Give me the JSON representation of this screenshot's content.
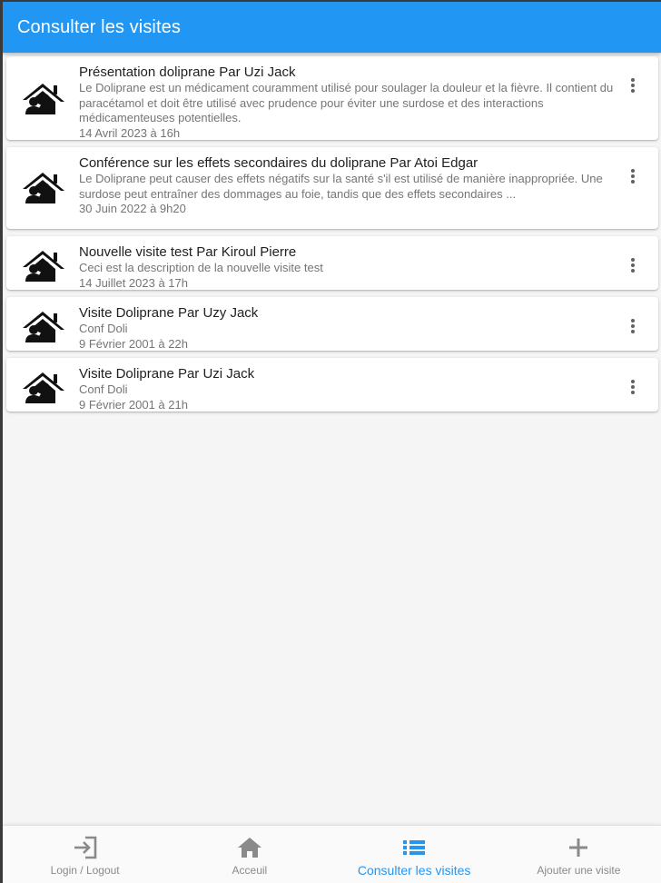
{
  "app": {
    "title": "Consulter les visites",
    "accent_color": "#2196f3"
  },
  "visits": [
    {
      "title": "Présentation doliprane Par Uzi Jack",
      "description": "Le Doliprane est un médicament couramment utilisé pour soulager la douleur et la fièvre. Il contient du paracétamol et doit être utilisé avec prudence pour éviter une surdose et des interactions médicamenteuses potentielles.",
      "date": "14 Avril 2023 à 16h",
      "icon": "people-house-icon"
    },
    {
      "title": "Conférence sur les effets secondaires du doliprane Par Atoi Edgar",
      "description": "Le Doliprane peut causer des effets négatifs sur la santé s'il est utilisé de manière inappropriée. Une surdose peut entraîner des dommages au foie, tandis que des effets secondaires ...",
      "date": "30 Juin 2022 à 9h20",
      "icon": "people-house-icon"
    },
    {
      "title": "Nouvelle visite test Par Kiroul Pierre",
      "description": "Ceci est la description de la nouvelle visite test",
      "date": "14 Juillet 2023 à 17h",
      "icon": "people-house-icon"
    },
    {
      "title": "Visite Doliprane Par Uzy Jack",
      "description": "Conf Doli",
      "date": "9 Février 2001 à 22h",
      "icon": "people-house-icon"
    },
    {
      "title": "Visite Doliprane Par Uzi Jack",
      "description": "Conf Doli",
      "date": "9 Février 2001 à 21h",
      "icon": "people-house-icon"
    }
  ],
  "bottom_nav": {
    "items": [
      {
        "label": "Login / Logout",
        "icon": "login-icon",
        "active": false
      },
      {
        "label": "Acceuil",
        "icon": "home-icon",
        "active": false
      },
      {
        "label": "Consulter les visites",
        "icon": "list-icon",
        "active": true
      },
      {
        "label": "Ajouter une visite",
        "icon": "add-icon",
        "active": false
      }
    ]
  }
}
